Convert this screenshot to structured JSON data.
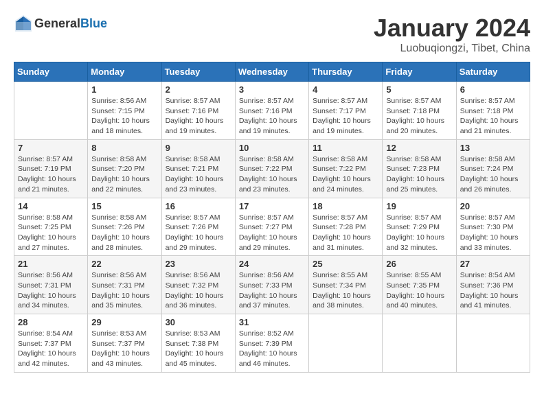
{
  "header": {
    "logo_general": "General",
    "logo_blue": "Blue",
    "month": "January 2024",
    "location": "Luobuqiongzi, Tibet, China"
  },
  "days_of_week": [
    "Sunday",
    "Monday",
    "Tuesday",
    "Wednesday",
    "Thursday",
    "Friday",
    "Saturday"
  ],
  "weeks": [
    [
      {
        "day": "",
        "sunrise": "",
        "sunset": "",
        "daylight": ""
      },
      {
        "day": "1",
        "sunrise": "Sunrise: 8:56 AM",
        "sunset": "Sunset: 7:15 PM",
        "daylight": "Daylight: 10 hours and 18 minutes."
      },
      {
        "day": "2",
        "sunrise": "Sunrise: 8:57 AM",
        "sunset": "Sunset: 7:16 PM",
        "daylight": "Daylight: 10 hours and 19 minutes."
      },
      {
        "day": "3",
        "sunrise": "Sunrise: 8:57 AM",
        "sunset": "Sunset: 7:16 PM",
        "daylight": "Daylight: 10 hours and 19 minutes."
      },
      {
        "day": "4",
        "sunrise": "Sunrise: 8:57 AM",
        "sunset": "Sunset: 7:17 PM",
        "daylight": "Daylight: 10 hours and 19 minutes."
      },
      {
        "day": "5",
        "sunrise": "Sunrise: 8:57 AM",
        "sunset": "Sunset: 7:18 PM",
        "daylight": "Daylight: 10 hours and 20 minutes."
      },
      {
        "day": "6",
        "sunrise": "Sunrise: 8:57 AM",
        "sunset": "Sunset: 7:18 PM",
        "daylight": "Daylight: 10 hours and 21 minutes."
      }
    ],
    [
      {
        "day": "7",
        "sunrise": "Sunrise: 8:57 AM",
        "sunset": "Sunset: 7:19 PM",
        "daylight": "Daylight: 10 hours and 21 minutes."
      },
      {
        "day": "8",
        "sunrise": "Sunrise: 8:58 AM",
        "sunset": "Sunset: 7:20 PM",
        "daylight": "Daylight: 10 hours and 22 minutes."
      },
      {
        "day": "9",
        "sunrise": "Sunrise: 8:58 AM",
        "sunset": "Sunset: 7:21 PM",
        "daylight": "Daylight: 10 hours and 23 minutes."
      },
      {
        "day": "10",
        "sunrise": "Sunrise: 8:58 AM",
        "sunset": "Sunset: 7:22 PM",
        "daylight": "Daylight: 10 hours and 23 minutes."
      },
      {
        "day": "11",
        "sunrise": "Sunrise: 8:58 AM",
        "sunset": "Sunset: 7:22 PM",
        "daylight": "Daylight: 10 hours and 24 minutes."
      },
      {
        "day": "12",
        "sunrise": "Sunrise: 8:58 AM",
        "sunset": "Sunset: 7:23 PM",
        "daylight": "Daylight: 10 hours and 25 minutes."
      },
      {
        "day": "13",
        "sunrise": "Sunrise: 8:58 AM",
        "sunset": "Sunset: 7:24 PM",
        "daylight": "Daylight: 10 hours and 26 minutes."
      }
    ],
    [
      {
        "day": "14",
        "sunrise": "Sunrise: 8:58 AM",
        "sunset": "Sunset: 7:25 PM",
        "daylight": "Daylight: 10 hours and 27 minutes."
      },
      {
        "day": "15",
        "sunrise": "Sunrise: 8:58 AM",
        "sunset": "Sunset: 7:26 PM",
        "daylight": "Daylight: 10 hours and 28 minutes."
      },
      {
        "day": "16",
        "sunrise": "Sunrise: 8:57 AM",
        "sunset": "Sunset: 7:26 PM",
        "daylight": "Daylight: 10 hours and 29 minutes."
      },
      {
        "day": "17",
        "sunrise": "Sunrise: 8:57 AM",
        "sunset": "Sunset: 7:27 PM",
        "daylight": "Daylight: 10 hours and 29 minutes."
      },
      {
        "day": "18",
        "sunrise": "Sunrise: 8:57 AM",
        "sunset": "Sunset: 7:28 PM",
        "daylight": "Daylight: 10 hours and 31 minutes."
      },
      {
        "day": "19",
        "sunrise": "Sunrise: 8:57 AM",
        "sunset": "Sunset: 7:29 PM",
        "daylight": "Daylight: 10 hours and 32 minutes."
      },
      {
        "day": "20",
        "sunrise": "Sunrise: 8:57 AM",
        "sunset": "Sunset: 7:30 PM",
        "daylight": "Daylight: 10 hours and 33 minutes."
      }
    ],
    [
      {
        "day": "21",
        "sunrise": "Sunrise: 8:56 AM",
        "sunset": "Sunset: 7:31 PM",
        "daylight": "Daylight: 10 hours and 34 minutes."
      },
      {
        "day": "22",
        "sunrise": "Sunrise: 8:56 AM",
        "sunset": "Sunset: 7:31 PM",
        "daylight": "Daylight: 10 hours and 35 minutes."
      },
      {
        "day": "23",
        "sunrise": "Sunrise: 8:56 AM",
        "sunset": "Sunset: 7:32 PM",
        "daylight": "Daylight: 10 hours and 36 minutes."
      },
      {
        "day": "24",
        "sunrise": "Sunrise: 8:56 AM",
        "sunset": "Sunset: 7:33 PM",
        "daylight": "Daylight: 10 hours and 37 minutes."
      },
      {
        "day": "25",
        "sunrise": "Sunrise: 8:55 AM",
        "sunset": "Sunset: 7:34 PM",
        "daylight": "Daylight: 10 hours and 38 minutes."
      },
      {
        "day": "26",
        "sunrise": "Sunrise: 8:55 AM",
        "sunset": "Sunset: 7:35 PM",
        "daylight": "Daylight: 10 hours and 40 minutes."
      },
      {
        "day": "27",
        "sunrise": "Sunrise: 8:54 AM",
        "sunset": "Sunset: 7:36 PM",
        "daylight": "Daylight: 10 hours and 41 minutes."
      }
    ],
    [
      {
        "day": "28",
        "sunrise": "Sunrise: 8:54 AM",
        "sunset": "Sunset: 7:37 PM",
        "daylight": "Daylight: 10 hours and 42 minutes."
      },
      {
        "day": "29",
        "sunrise": "Sunrise: 8:53 AM",
        "sunset": "Sunset: 7:37 PM",
        "daylight": "Daylight: 10 hours and 43 minutes."
      },
      {
        "day": "30",
        "sunrise": "Sunrise: 8:53 AM",
        "sunset": "Sunset: 7:38 PM",
        "daylight": "Daylight: 10 hours and 45 minutes."
      },
      {
        "day": "31",
        "sunrise": "Sunrise: 8:52 AM",
        "sunset": "Sunset: 7:39 PM",
        "daylight": "Daylight: 10 hours and 46 minutes."
      },
      {
        "day": "",
        "sunrise": "",
        "sunset": "",
        "daylight": ""
      },
      {
        "day": "",
        "sunrise": "",
        "sunset": "",
        "daylight": ""
      },
      {
        "day": "",
        "sunrise": "",
        "sunset": "",
        "daylight": ""
      }
    ]
  ]
}
